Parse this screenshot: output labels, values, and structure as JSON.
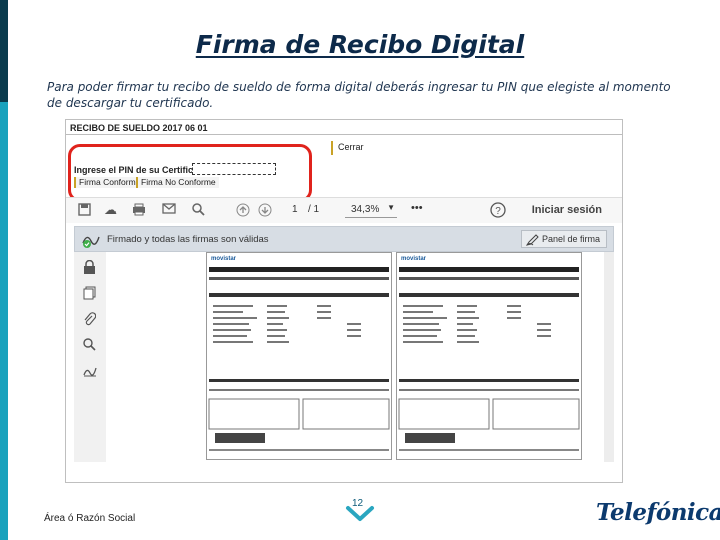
{
  "slide": {
    "title": "Firma de Recibo Digital",
    "intro": "Para poder firmar tu recibo de sueldo de forma digital deberás ingresar tu PIN que elegiste al momento de descargar tu certificado.",
    "footer_left": "Área ó Razón Social",
    "page_number": "12",
    "brand": "Telefónica"
  },
  "screenshot": {
    "header": "RECIBO DE SUELDO 2017 06 01",
    "cerrar_label": "Cerrar",
    "pin_label": "Ingrese el PIN de su Certificado:",
    "firma_conforme": "Firma Conforme",
    "firma_no_conforme": "Firma No Conforme",
    "toolbar": {
      "page_current": "1",
      "page_total": "/ 1",
      "zoom": "34,3%",
      "more": "•••",
      "help": "?",
      "login": "Iniciar sesión"
    },
    "signature_status": "Firmado y todas las firmas son válidas",
    "signature_panel": "Panel de firma",
    "document_brand": "movistar"
  },
  "colors": {
    "title": "#0d2a4a",
    "accent_dark": "#0a3b4d",
    "accent_light": "#19a2bd",
    "highlight": "#e0231c",
    "chevron": "#2aa6c0",
    "brand": "#0c3a6e"
  }
}
